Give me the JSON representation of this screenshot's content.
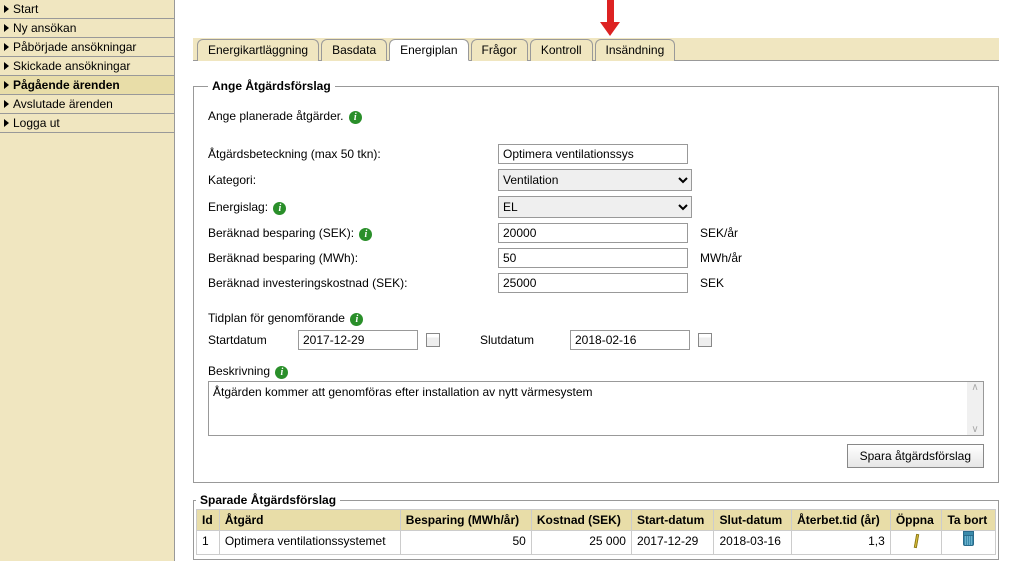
{
  "sidebar": {
    "items": [
      {
        "label": "Start"
      },
      {
        "label": "Ny ansökan"
      },
      {
        "label": "Påbörjade ansökningar"
      },
      {
        "label": "Skickade ansökningar"
      },
      {
        "label": "Pågående ärenden",
        "active": true
      },
      {
        "label": "Avslutade ärenden"
      },
      {
        "label": "Logga ut"
      }
    ]
  },
  "tabs": [
    {
      "label": "Energikartläggning"
    },
    {
      "label": "Basdata"
    },
    {
      "label": "Energiplan",
      "active": true
    },
    {
      "label": "Frågor"
    },
    {
      "label": "Kontroll"
    },
    {
      "label": "Insändning"
    }
  ],
  "form": {
    "legend": "Ange Åtgärdsförslag",
    "intro": "Ange planerade åtgärder.",
    "beteckning_label": "Åtgärdsbeteckning (max 50 tkn):",
    "beteckning_value": "Optimera ventilationssys",
    "kategori_label": "Kategori:",
    "kategori_value": "Ventilation",
    "energislag_label": "Energislag:",
    "energislag_value": "EL",
    "besparing_sek_label": "Beräknad besparing (SEK):",
    "besparing_sek_value": "20000",
    "besparing_sek_unit": "SEK/år",
    "besparing_mwh_label": "Beräknad besparing (MWh):",
    "besparing_mwh_value": "50",
    "besparing_mwh_unit": "MWh/år",
    "investering_label": "Beräknad investeringskostnad (SEK):",
    "investering_value": "25000",
    "investering_unit": "SEK",
    "tidplan_title": "Tidplan för genomförande",
    "start_label": "Startdatum",
    "start_value": "2017-12-29",
    "slut_label": "Slutdatum",
    "slut_value": "2018-02-16",
    "beskrivning_label": "Beskrivning",
    "beskrivning_value": "Åtgärden kommer att genomföras efter installation av nytt värmesystem",
    "save_button": "Spara åtgärdsförslag"
  },
  "saved": {
    "legend": "Sparade Åtgärdsförslag",
    "headers": {
      "id": "Id",
      "atgard": "Åtgärd",
      "besparing": "Besparing (MWh/år)",
      "kostnad": "Kostnad (SEK)",
      "start": "Start-datum",
      "slut": "Slut-datum",
      "aterbet": "Återbet.tid (år)",
      "oppna": "Öppna",
      "tabort": "Ta bort"
    },
    "rows": [
      {
        "id": "1",
        "atgard": "Optimera ventilationssystemet",
        "besparing": "50",
        "kostnad": "25 000",
        "start": "2017-12-29",
        "slut": "2018-03-16",
        "aterbet": "1,3"
      }
    ]
  }
}
